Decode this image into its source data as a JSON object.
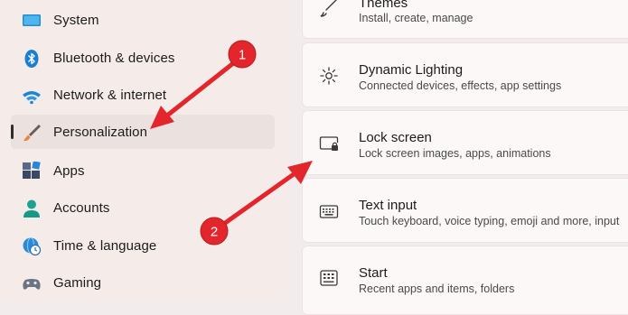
{
  "sidebar": {
    "items": [
      {
        "label": "System",
        "icon": "monitor-icon"
      },
      {
        "label": "Bluetooth & devices",
        "icon": "bluetooth-icon"
      },
      {
        "label": "Network & internet",
        "icon": "wifi-icon"
      },
      {
        "label": "Personalization",
        "icon": "brush-icon",
        "selected": true
      },
      {
        "label": "Apps",
        "icon": "apps-icon"
      },
      {
        "label": "Accounts",
        "icon": "person-icon"
      },
      {
        "label": "Time & language",
        "icon": "globe-clock-icon"
      },
      {
        "label": "Gaming",
        "icon": "controller-icon"
      }
    ]
  },
  "main": {
    "cards": [
      {
        "title": "Themes",
        "desc": "Install, create, manage",
        "icon": "brush-icon"
      },
      {
        "title": "Dynamic Lighting",
        "desc": "Connected devices, effects, app settings",
        "icon": "sun-burst-icon"
      },
      {
        "title": "Lock screen",
        "desc": "Lock screen images, apps, animations",
        "icon": "lock-screen-icon"
      },
      {
        "title": "Text input",
        "desc": "Touch keyboard, voice typing, emoji and more, input",
        "icon": "keyboard-icon"
      },
      {
        "title": "Start",
        "desc": "Recent apps and items, folders",
        "icon": "start-menu-icon"
      }
    ]
  },
  "annotations": {
    "badge1": "1",
    "badge2": "2",
    "color": "#e3262b"
  }
}
